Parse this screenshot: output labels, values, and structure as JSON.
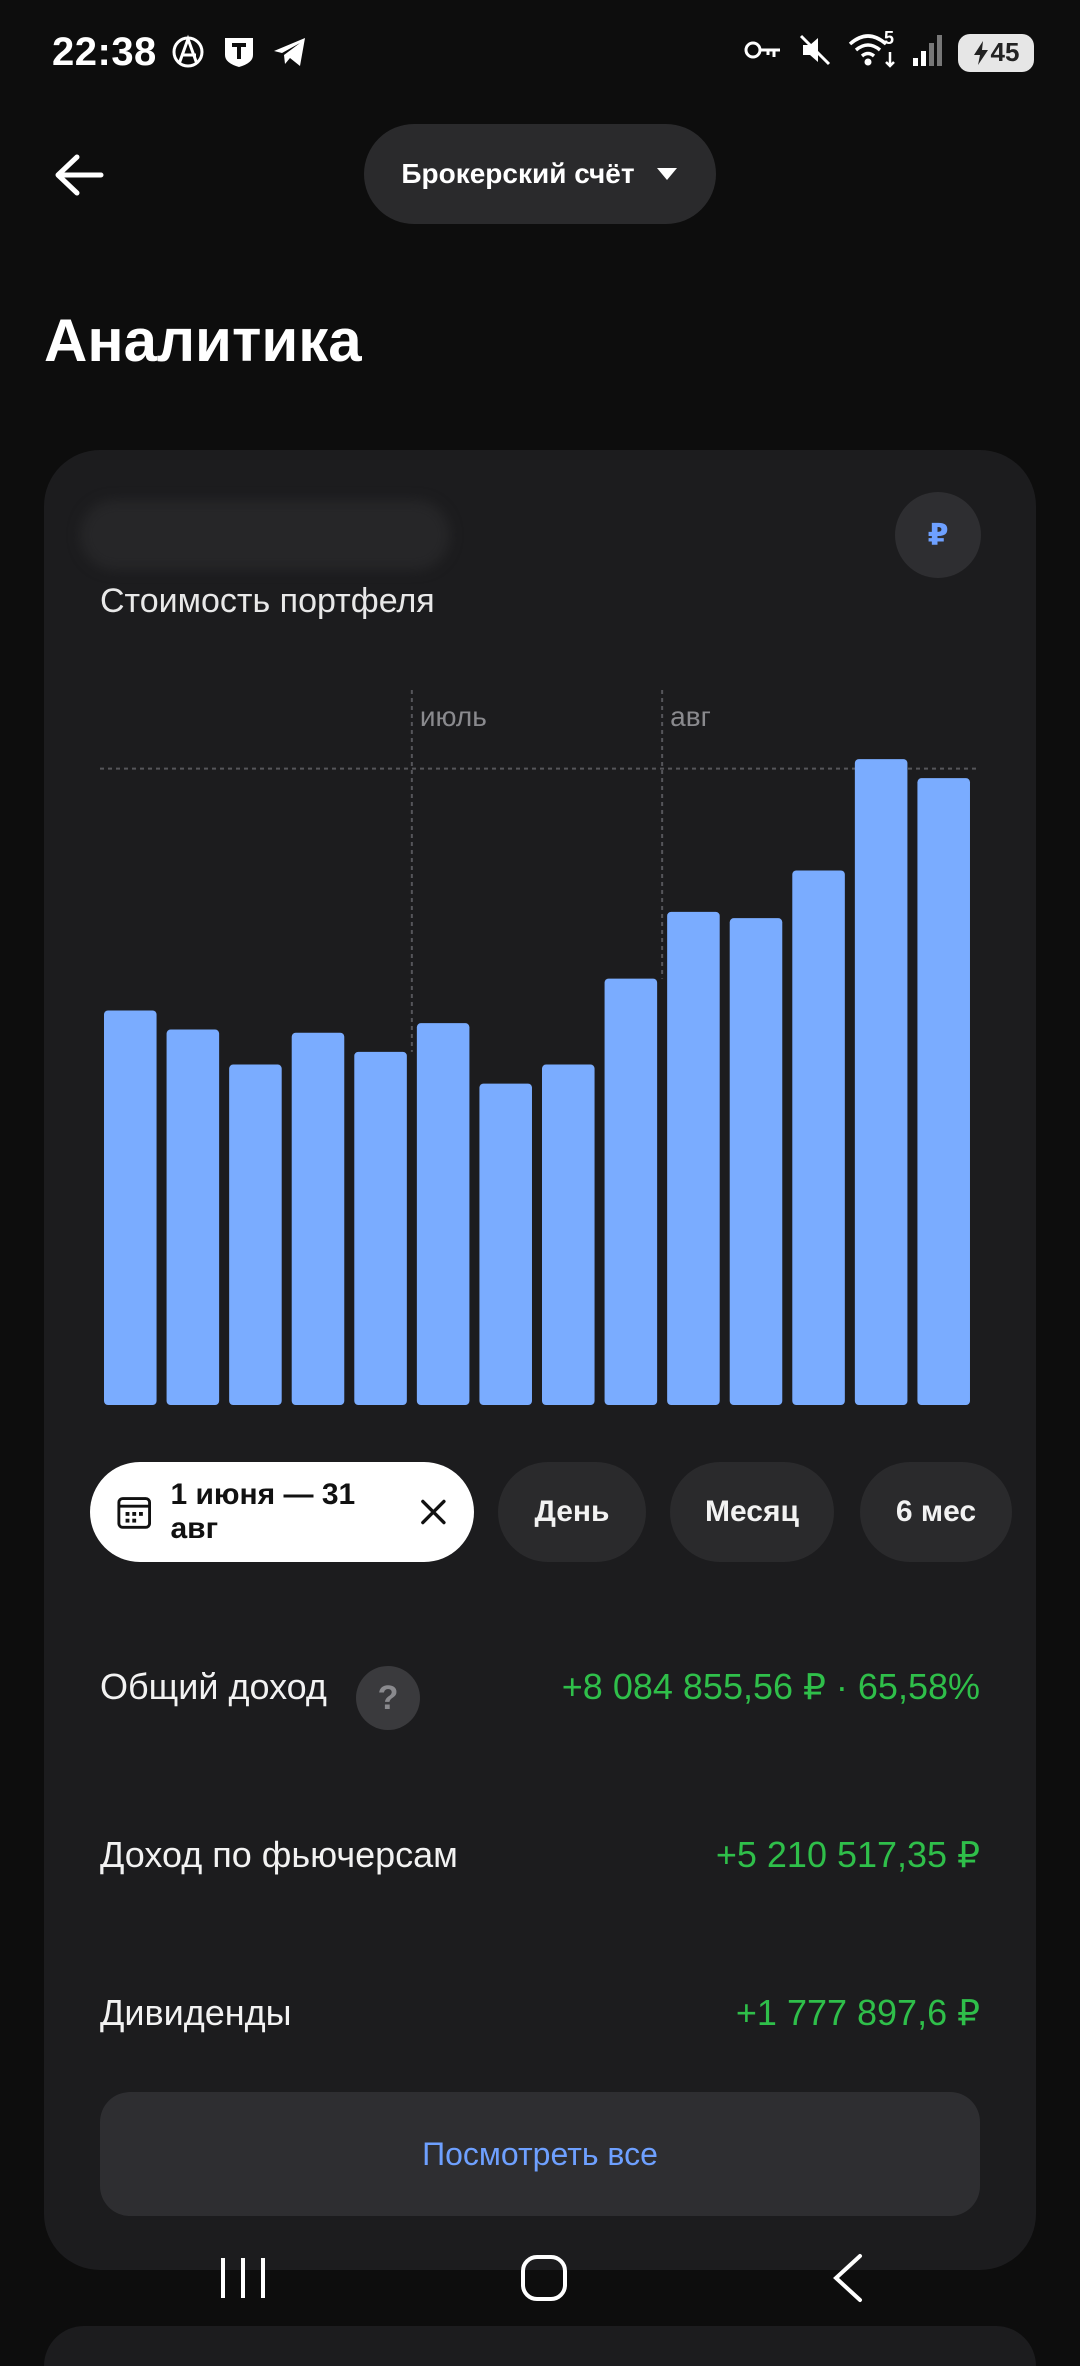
{
  "status_bar": {
    "time": "22:38",
    "battery": "45",
    "signal_label": "5",
    "icons_left": [
      "anarchy-icon",
      "t-bank-icon",
      "telegram-icon"
    ],
    "icons_right": [
      "key-icon",
      "mute-icon",
      "wifi-icon",
      "signal-icon",
      "battery-icon"
    ]
  },
  "header": {
    "back_icon": "arrow-left-icon",
    "account_selector": "Брокерский счёт",
    "page_title": "Аналитика"
  },
  "card": {
    "currency_symbol": "₽",
    "subtitle": "Стоимость портфеля"
  },
  "chart_data": {
    "type": "bar",
    "title": "Стоимость портфеля",
    "xlabel": "",
    "ylabel": "",
    "month_markers": [
      {
        "label": "июль",
        "after_bar_index": 4
      },
      {
        "label": "авг",
        "after_bar_index": 8
      }
    ],
    "values": [
      62,
      59,
      53.5,
      58.5,
      55.5,
      60,
      50.5,
      53.5,
      67,
      77.5,
      76.5,
      84,
      101.5,
      98.5
    ],
    "ylim": [
      0,
      110
    ],
    "reference_line": 100,
    "bar_color": "#7aacff",
    "grid": false
  },
  "period_filter": {
    "active_range": "1 июня — 31 авг",
    "chips": [
      "День",
      "Месяц",
      "6 мес"
    ]
  },
  "stats": {
    "total_income_label": "Общий доход",
    "total_income_value": "+8 084 855,56 ₽ · 65,58%",
    "help_symbol": "?",
    "futures_income_label": "Доход по фьючерсам",
    "futures_income_value": "+5 210 517,35 ₽",
    "dividends_label": "Дивиденды",
    "dividends_value": "+1 777 897,6 ₽",
    "see_all_label": "Посмотреть все"
  },
  "colors": {
    "background": "#0d0d0d",
    "card": "#1c1c1e",
    "accent_blue": "#6ea0ff",
    "positive_green": "#2fbf4a",
    "bar_blue": "#7aacff"
  }
}
